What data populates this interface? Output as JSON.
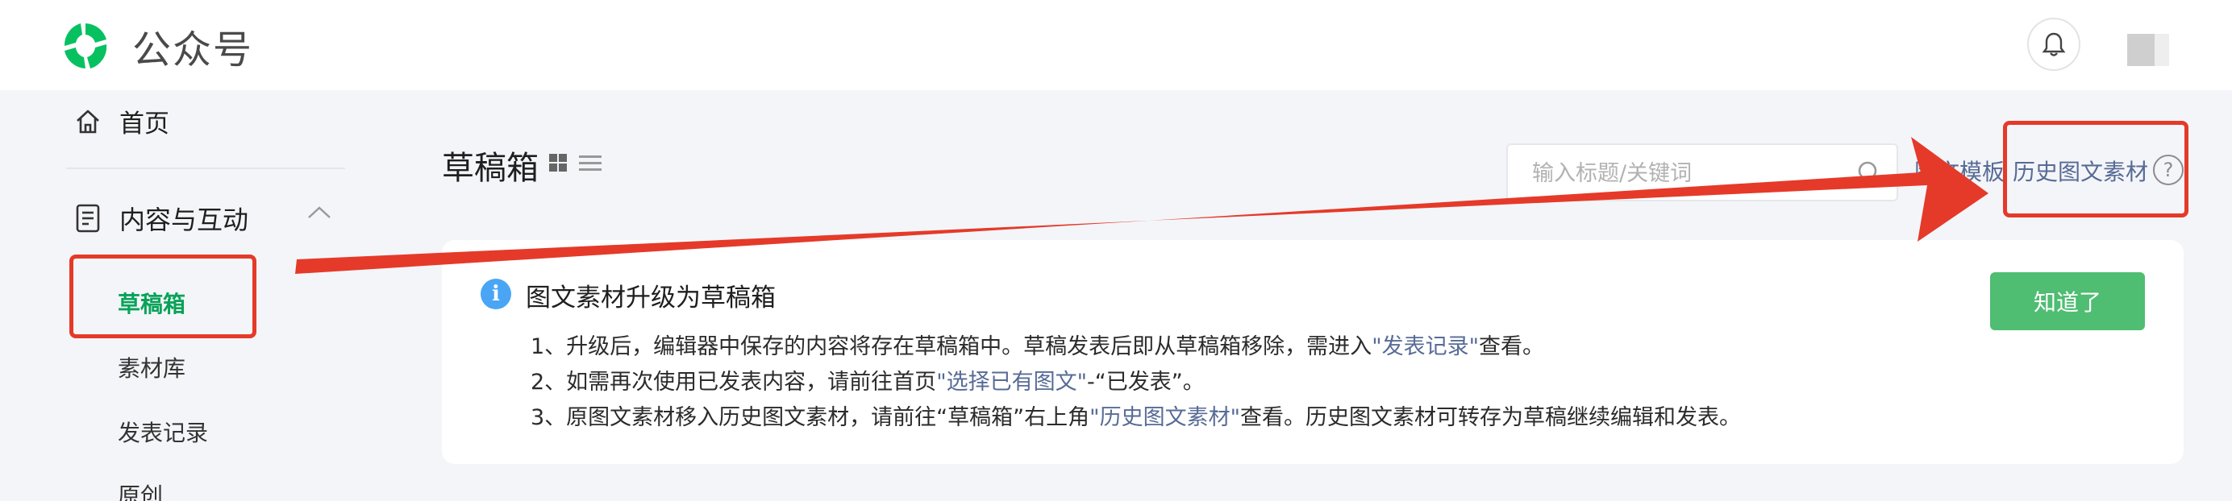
{
  "header": {
    "app_name": "公众号",
    "bell_icon": "bell-icon",
    "avatar": "avatar"
  },
  "sidebar": {
    "home": "首页",
    "group": "内容与互动",
    "items": [
      {
        "label": "草稿箱",
        "active": true
      },
      {
        "label": "素材库",
        "active": false
      },
      {
        "label": "发表记录",
        "active": false
      },
      {
        "label": "原创",
        "active": false
      }
    ]
  },
  "main": {
    "title": "草稿箱",
    "search_placeholder": "输入标题/关键词",
    "link_template": "图文模板",
    "link_history": "历史图文素材",
    "help_icon": "?"
  },
  "notice": {
    "info_icon": "i",
    "title": "图文素材升级为草稿箱",
    "line1": {
      "pre": "1、升级后，编辑器中保存的内容将存在草稿箱中。草稿发表后即从草稿箱移除，需进入",
      "link": "\"发表记录\"",
      "post": "查看。"
    },
    "line2": {
      "pre": "2、如需再次使用已发表内容，请前往首页",
      "link": "\"选择已有图文\"",
      "post": "-“已发表”。"
    },
    "line3": {
      "pre": "3、原图文素材移入历史图文素材，请前往“草稿箱”右上角",
      "link": "\"历史图文素材\"",
      "post": "查看。历史图文素材可转存为草稿继续编辑和发表。"
    },
    "button": "知道了"
  },
  "colors": {
    "accent_green": "#07a358",
    "button_green": "#4fbd72",
    "link_blue": "#576b95",
    "annotation_red": "#e53a29"
  }
}
